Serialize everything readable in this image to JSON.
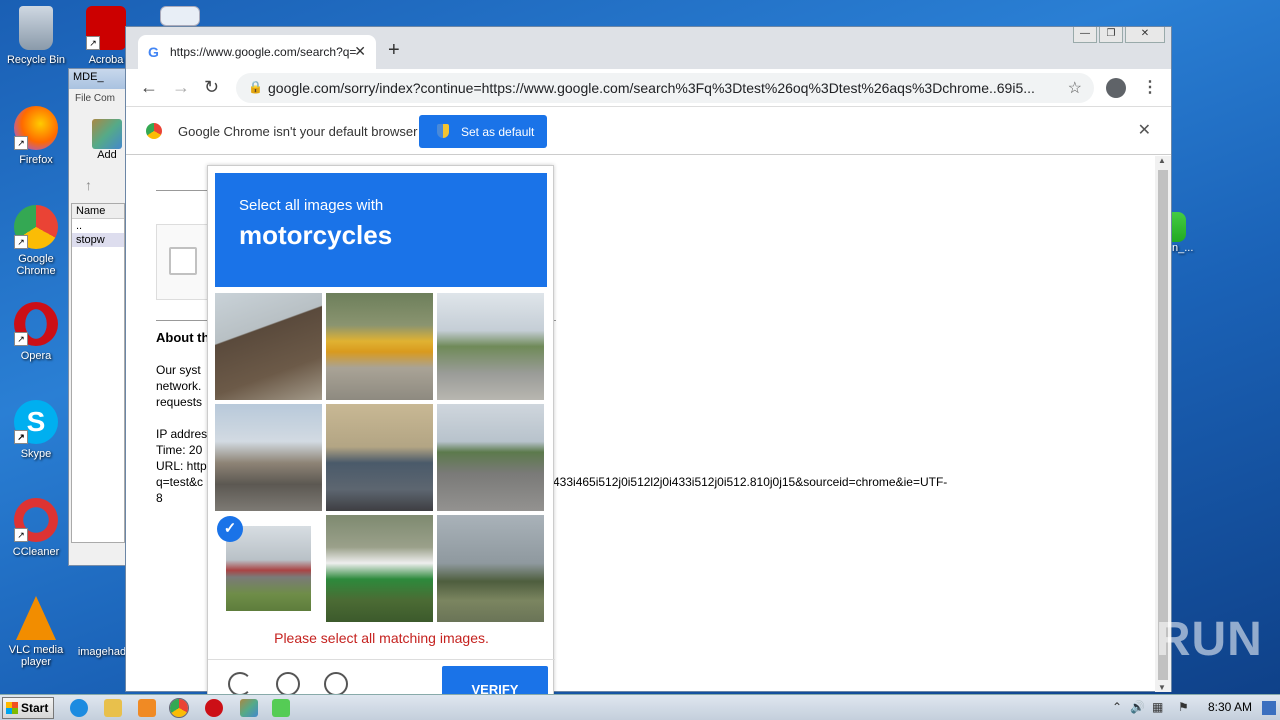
{
  "desktop": {
    "icons": [
      {
        "label": "Recycle Bin",
        "color": "#7a8ea8"
      },
      {
        "label": "Firefox",
        "color": "#e66000"
      },
      {
        "label": "Google Chrome",
        "color": "#4285f4"
      },
      {
        "label": "Opera",
        "color": "#cc0f16"
      },
      {
        "label": "Skype",
        "color": "#00aff0"
      },
      {
        "label": "CCleaner",
        "color": "#d33"
      },
      {
        "label": "VLC media player",
        "color": "#f28d00"
      }
    ],
    "top_icons": [
      "Acroba",
      ""
    ],
    "bottom_label": "imagehad",
    "right_partial": "n_..."
  },
  "bg_window": {
    "title": "MDE_",
    "menu": "File  Com",
    "add_label": "Add",
    "list_header": "Name",
    "list_items": [
      "..",
      "stopw"
    ]
  },
  "chrome": {
    "tab_title": "https://www.google.com/search?q=",
    "url": "google.com/sorry/index?continue=https://www.google.com/search%3Fq%3Dtest%26oq%3Dtest%26aqs%3Dchrome..69i5...",
    "infobar_message": "Google Chrome isn't your default browser",
    "set_default_label": "Set as default"
  },
  "page": {
    "about_heading": "About th",
    "para_lines": [
      "Our syst",
      "network.",
      "requests"
    ],
    "info_lines": [
      "IP addres",
      "Time: 20",
      "URL: http",
      "q=test&c",
      "8"
    ],
    "url_tail": "433i465i512j0i512l2j0i433i512j0i512.810j0j15&sourceid=chrome&ie=UTF-"
  },
  "captcha": {
    "instruction": "Select all images with",
    "target": "motorcycles",
    "error": "Please select all matching images.",
    "verify_label": "VERIFY",
    "tiles": [
      {
        "bg": "linear-gradient(160deg,#c9d2d8 0%,#b8c0c4 35%,#5a4a3c 36%,#6c5a48 70%,#a39a8a 100%)",
        "selected": false
      },
      {
        "bg": "linear-gradient(180deg,#6d7f5b 0%,#8a9470 30%,#e0b232 45%,#d99a1e 55%,#a9a396 70%,#8e8a80 100%)",
        "selected": false
      },
      {
        "bg": "linear-gradient(180deg,#dfe5ea 0%,#c5ced6 35%,#6f8a58 50%,#9a9c98 75%,#b8b6b0 100%)",
        "selected": false
      },
      {
        "bg": "linear-gradient(180deg,#b8c9da 0%,#d2dae2 35%,#8e8476 55%,#5c5852 75%,#7d7a74 100%)",
        "selected": false
      },
      {
        "bg": "linear-gradient(180deg,#c8b894 0%,#b3a584 40%,#4a5a6a 55%,#5d6670 80%,#3e3e42 100%)",
        "selected": false
      },
      {
        "bg": "linear-gradient(180deg,#cfd6dd 0%,#b8c3cc 35%,#5c7a4c 45%,#7a7a78 65%,#939290 100%)",
        "selected": false
      },
      {
        "bg": "linear-gradient(180deg,#d7dde2 0%,#b9c1c7 40%,#a44 52%,#7a7a78 60%,#6f8d48 80%,#5e7d3c 100%)",
        "selected": true
      },
      {
        "bg": "linear-gradient(180deg,#7e8a70 0%,#9aa08a 30%,#eee 45%,#2d8a3c 60%,#4b6b34 80%,#3c5a2c 100%)",
        "selected": false
      },
      {
        "bg": "linear-gradient(180deg,#a9b2b9 0%,#8f999f 45%,#4e5e3e 62%,#7b8560 80%,#6a7457 100%)",
        "selected": false
      }
    ]
  },
  "watermark": "ANY RUN",
  "taskbar": {
    "start_label": "Start",
    "clock": "8:30 AM"
  }
}
